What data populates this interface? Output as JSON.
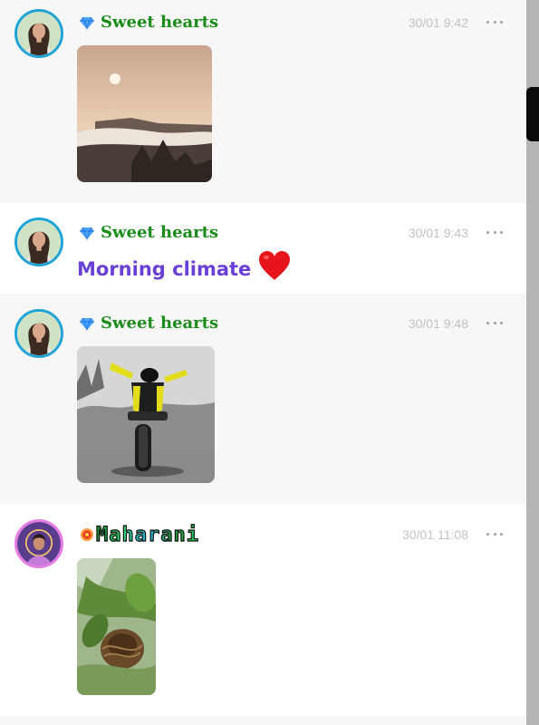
{
  "messages": [
    {
      "user": "Sweet hearts",
      "time": "30/01 9:42",
      "type": "image",
      "image": "sunrise-over-clouds-photo"
    },
    {
      "user": "Sweet hearts",
      "time": "30/01 9:43",
      "type": "text",
      "text": "Morning climate",
      "emoji": "red-heart"
    },
    {
      "user": "Sweet hearts",
      "time": "30/01 9:48",
      "type": "image",
      "image": "yellow-motorcycle-photo"
    },
    {
      "user": "Maharani",
      "time": "30/01 11:08",
      "type": "image",
      "image": "bird-nest-photo"
    }
  ],
  "colors": {
    "username": "#1a8c1a",
    "message_text": "#6a3fd6",
    "timestamp": "#c2c2c2",
    "avatar_ring_blue": "#1fa3d7",
    "avatar_ring_pink": "#e77be6",
    "scrollbar_thumb": "#0b0b0b"
  },
  "icons": [
    "diamond-badge-icon",
    "flower-badge-icon",
    "more-options-icon",
    "heart-emoji-icon"
  ]
}
